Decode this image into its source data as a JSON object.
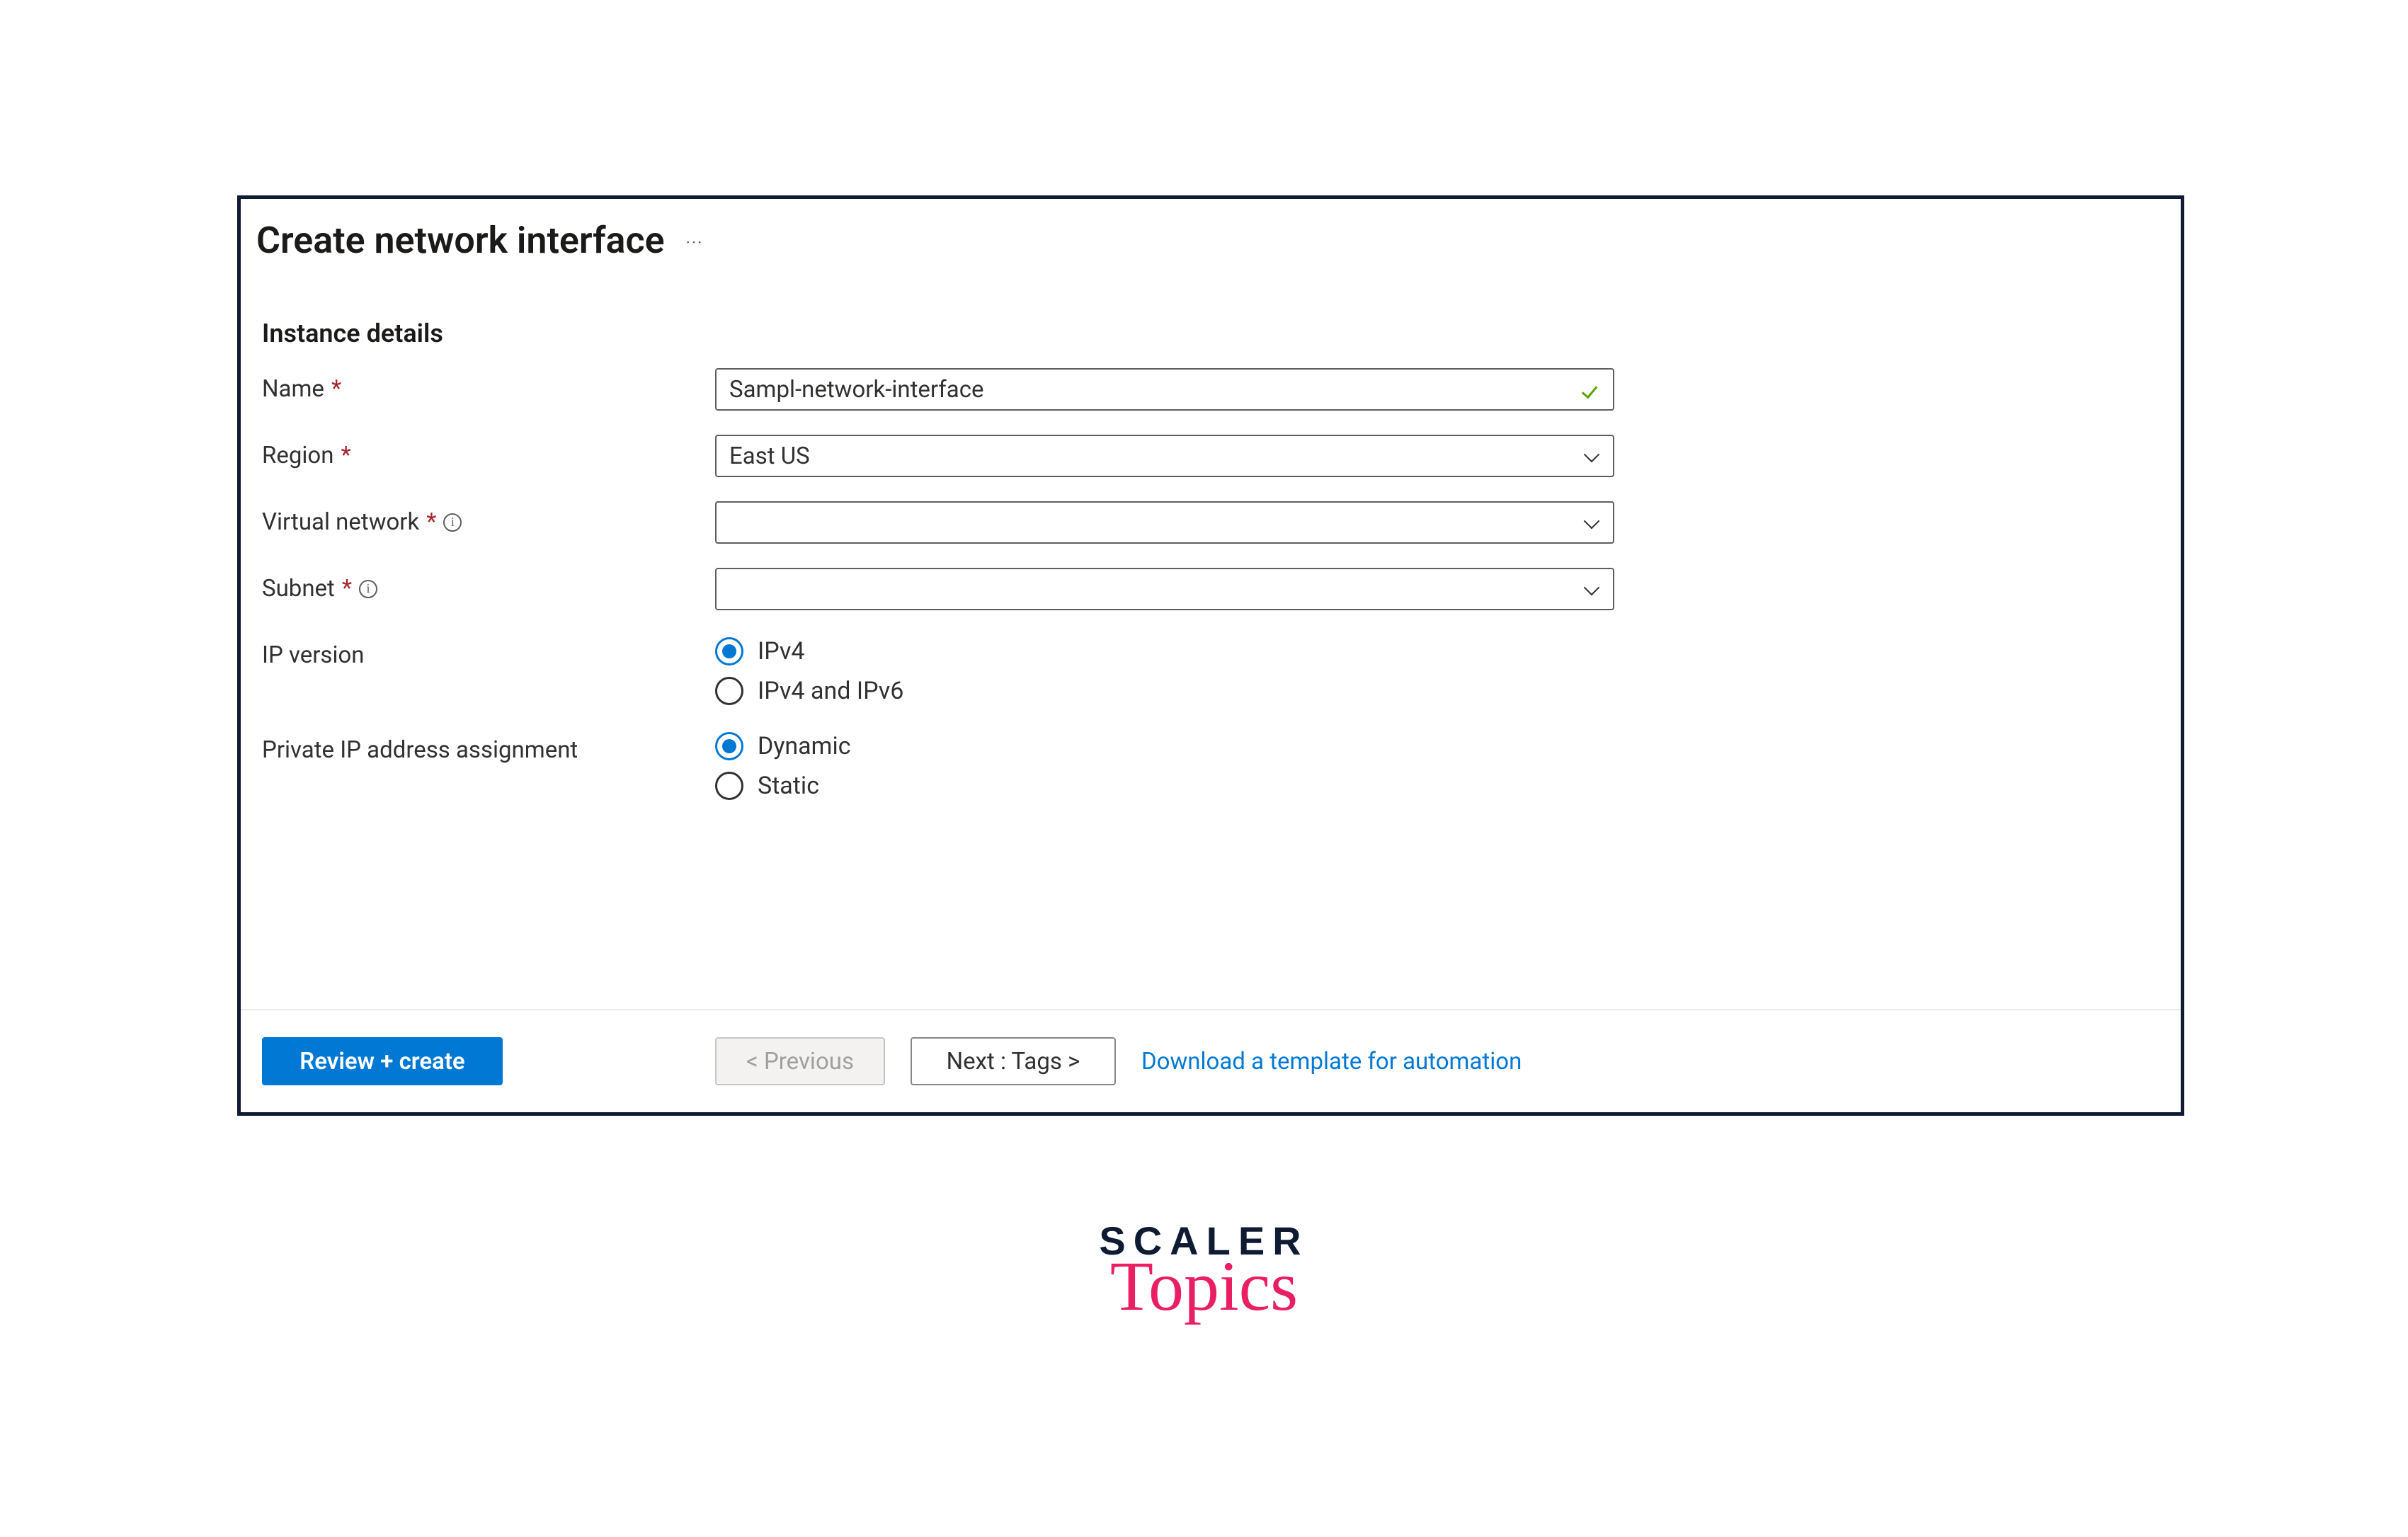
{
  "header": {
    "title": "Create network interface",
    "more": "···"
  },
  "section": {
    "heading": "Instance details"
  },
  "fields": {
    "name": {
      "label": "Name",
      "value": "Sampl-network-interface",
      "required": true
    },
    "region": {
      "label": "Region",
      "value": "East US",
      "required": true
    },
    "vnet": {
      "label": "Virtual network",
      "value": "",
      "required": true
    },
    "subnet": {
      "label": "Subnet",
      "value": "",
      "required": true
    },
    "ipversion": {
      "label": "IP version",
      "options": [
        "IPv4",
        "IPv4 and IPv6"
      ],
      "selected": "IPv4"
    },
    "privateip": {
      "label": "Private IP address assignment",
      "options": [
        "Dynamic",
        "Static"
      ],
      "selected": "Dynamic"
    }
  },
  "footer": {
    "review": "Review + create",
    "previous": "< Previous",
    "next": "Next : Tags >",
    "download": "Download a template for automation"
  },
  "logo": {
    "line1": "SCALER",
    "line2": "Topics"
  }
}
